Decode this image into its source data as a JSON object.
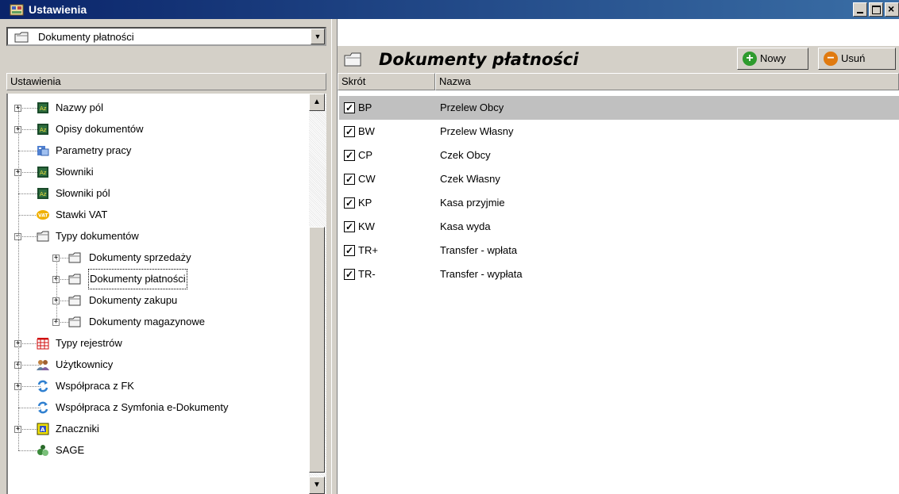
{
  "window": {
    "title": "Ustawienia",
    "icon": "settings-app-icon"
  },
  "left": {
    "combo_value": "Dokumenty płatności",
    "header": "Ustawienia",
    "tree": [
      {
        "label": "Nazwy pól",
        "icon": "az-dictionary-icon",
        "expandable": true
      },
      {
        "label": "Opisy dokumentów",
        "icon": "az-dictionary-icon",
        "expandable": true
      },
      {
        "label": "Parametry pracy",
        "icon": "work-parameters-icon",
        "expandable": false
      },
      {
        "label": "Słowniki",
        "icon": "az-dictionary-icon",
        "expandable": true
      },
      {
        "label": "Słowniki pól",
        "icon": "az-dictionary-icon",
        "expandable": false
      },
      {
        "label": "Stawki VAT",
        "icon": "vat-icon",
        "icon_text": "VAT",
        "expandable": false
      },
      {
        "label": "Typy dokumentów",
        "icon": "folder-icon",
        "expandable": true,
        "expanded": true
      },
      {
        "label": "Dokumenty sprzedaży",
        "icon": "folder-icon",
        "expandable": true,
        "level": 2
      },
      {
        "label": "Dokumenty płatności",
        "icon": "folder-icon",
        "expandable": true,
        "level": 2,
        "selected": true
      },
      {
        "label": "Dokumenty zakupu",
        "icon": "folder-icon",
        "expandable": true,
        "level": 2
      },
      {
        "label": "Dokumenty magazynowe",
        "icon": "folder-icon",
        "expandable": true,
        "level": 2
      },
      {
        "label": "Typy rejestrów",
        "icon": "register-grid-icon",
        "expandable": true
      },
      {
        "label": "Użytkownicy",
        "icon": "users-icon",
        "expandable": true
      },
      {
        "label": "Współpraca z FK",
        "icon": "sync-arrows-icon",
        "expandable": true
      },
      {
        "label": "Współpraca z Symfonia e-Dokumenty",
        "icon": "sync-arrows-icon",
        "expandable": false
      },
      {
        "label": "Znaczniki",
        "icon": "tag-a-icon",
        "expandable": true
      },
      {
        "label": "SAGE",
        "icon": "sage-dots-icon",
        "expandable": false
      }
    ]
  },
  "right": {
    "title": "Dokumenty płatności",
    "buttons": {
      "new": "Nowy",
      "delete": "Usuń"
    },
    "columns": {
      "short": "Skrót",
      "name": "Nazwa"
    },
    "rows": [
      {
        "code": "BP",
        "name": "Przelew Obcy",
        "checked": true
      },
      {
        "code": "BW",
        "name": "Przelew Własny",
        "checked": true
      },
      {
        "code": "CP",
        "name": "Czek Obcy",
        "checked": true
      },
      {
        "code": "CW",
        "name": "Czek Własny",
        "checked": true
      },
      {
        "code": "KP",
        "name": "Kasa przyjmie",
        "checked": true
      },
      {
        "code": "KW",
        "name": "Kasa wyda",
        "checked": true
      },
      {
        "code": "TR+",
        "name": "Transfer - wpłata",
        "checked": true
      },
      {
        "code": "TR-",
        "name": "Transfer - wypłata",
        "checked": true
      }
    ]
  },
  "colors": {
    "titlebar": "#0a246a",
    "selection": "#c0c0c0",
    "new_button": "#2e9b2e",
    "delete_button": "#e07a10"
  }
}
